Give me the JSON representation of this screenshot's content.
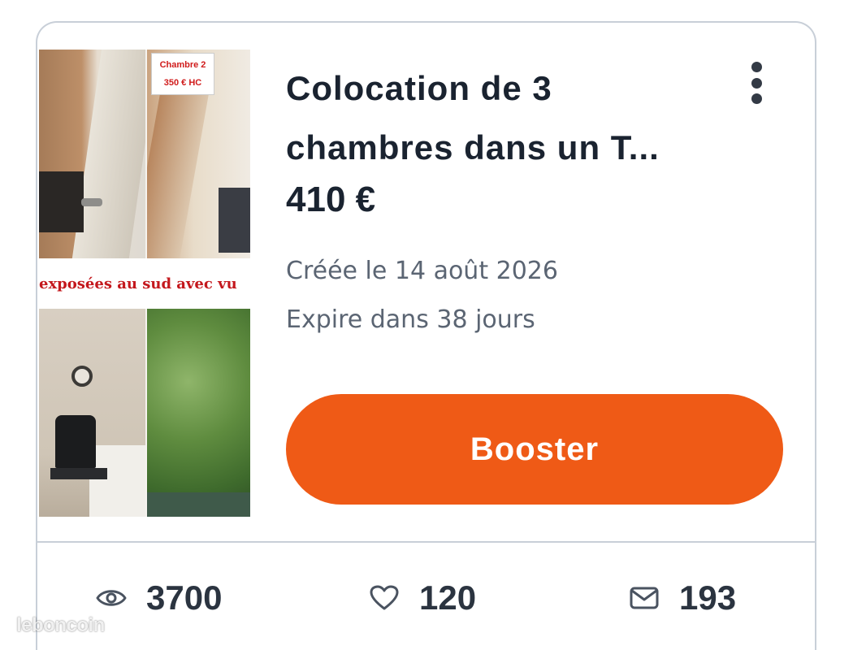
{
  "listing": {
    "image_label": {
      "line1": "Chambre 2",
      "line2": "350 € HC"
    },
    "image_banner": "exposées au sud avec vu",
    "title": "Colocation de 3 chambres dans un T...",
    "price": "410 €",
    "created": "Créée le 14 août 2026",
    "expires": "Expire dans 38 jours",
    "boost_label": "Booster"
  },
  "stats": {
    "views": "3700",
    "favorites": "120",
    "messages": "193"
  },
  "icons": {
    "more": "vertical-ellipsis-icon",
    "views": "eye-icon",
    "favorites": "heart-icon",
    "messages": "mail-icon"
  },
  "colors": {
    "accent": "#ef5a16",
    "text": "#1a2330",
    "muted": "#5b6573",
    "border": "#c8cfd8"
  },
  "watermark": "leboncoin"
}
